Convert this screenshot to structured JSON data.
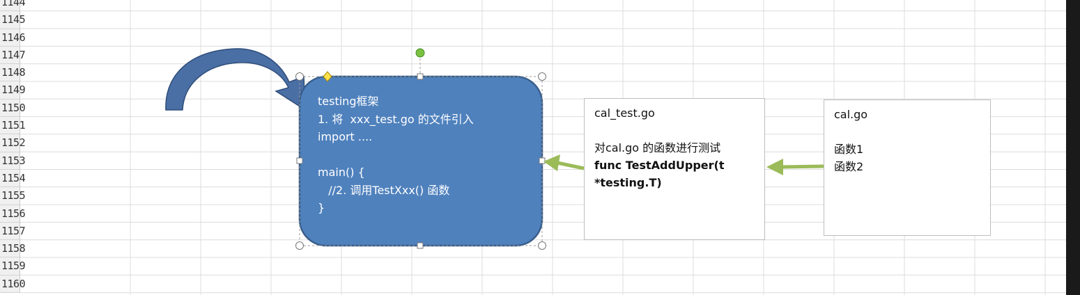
{
  "row_headers": [
    "1144",
    "1145",
    "1146",
    "1147",
    "1148",
    "1149",
    "1150",
    "1151",
    "1152",
    "1153",
    "1154",
    "1155",
    "1156",
    "1157",
    "1158",
    "1159",
    "1160"
  ],
  "colors": {
    "shape_fill": "#4f81bd",
    "shape_stroke": "#385d8a",
    "arrow_green": "#9bbb59",
    "curved_arrow_fill": "#4a6fa5",
    "rotation_handle": "#7ac142",
    "adjust_handle": "#ffe14a",
    "row_header_bg": "#f0f0f0"
  },
  "rounded_box": {
    "lines": [
      "testing框架",
      "1. 将  xxx_test.go 的文件引入",
      "import ....",
      "",
      "main() {",
      "   //2. 调用TestXxx() 函数",
      "}"
    ]
  },
  "cal_test_box": {
    "title": "cal_test.go",
    "desc": "对cal.go 的函数进行测试",
    "code_line1": "func TestAddUpper(t",
    "code_line2": "*testing.T)"
  },
  "cal_box": {
    "title": "cal.go",
    "item1": "函数1",
    "item2": "函数2"
  }
}
